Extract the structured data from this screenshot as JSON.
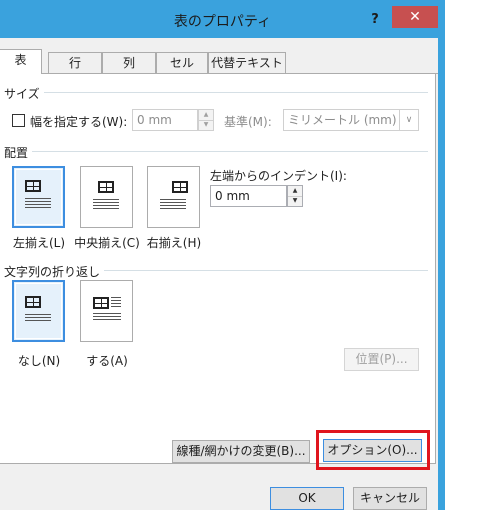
{
  "window": {
    "title": "表のプロパティ",
    "help": "?",
    "close": "✕"
  },
  "tabs": [
    {
      "label": "表"
    },
    {
      "label": "行"
    },
    {
      "label": "列"
    },
    {
      "label": "セル"
    },
    {
      "label": "代替テキスト"
    }
  ],
  "size": {
    "heading": "サイズ",
    "width_check_label": "幅を指定する(W):",
    "width_value": "0 mm",
    "unit_label": "基準(M):",
    "unit_value": "ミリメートル (mm)"
  },
  "alignment": {
    "heading": "配置",
    "options": [
      {
        "label": "左揃え(L)"
      },
      {
        "label": "中央揃え(C)"
      },
      {
        "label": "右揃え(H)"
      }
    ],
    "indent_label": "左端からのインデント(I):",
    "indent_value": "0 mm"
  },
  "wrapping": {
    "heading": "文字列の折り返し",
    "options": [
      {
        "label": "なし(N)"
      },
      {
        "label": "する(A)"
      }
    ],
    "position_button": "位置(P)..."
  },
  "footer": {
    "borders_button": "線種/網かけの変更(B)...",
    "options_button": "オプション(O)...",
    "ok_button": "OK",
    "cancel_button": "キャンセル"
  },
  "colors": {
    "titlebar": "#3aa2dd",
    "close": "#c75050",
    "selection": "#3d8ee0",
    "highlight": "#e0151e"
  }
}
